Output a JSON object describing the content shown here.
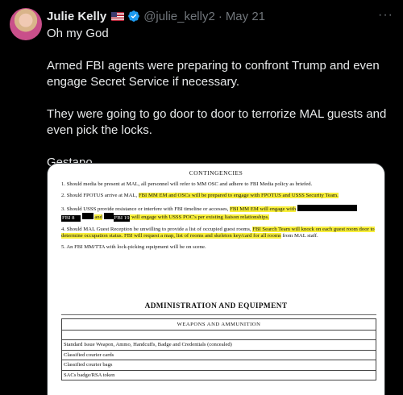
{
  "post": {
    "author_name": "Julie Kelly",
    "handle": "@julie_kelly2",
    "separator": "·",
    "date": "May 21",
    "more_label": "···",
    "paragraphs": [
      "Oh my God",
      "Armed FBI agents were preparing to confront Trump and even engage Secret Service if necessary.",
      "They were going to go door to door to terrorize MAL guests and even pick the locks.",
      "Gestapo"
    ]
  },
  "document": {
    "title": "CONTINGENCIES",
    "items": {
      "i1": "1. Should media be present at MAL, all personnel will refer to MM OSC and adhere to FBI Media policy as briefed.",
      "i2_a": "2. Should FPOTUS arrive at MAL, ",
      "i2_b": "FBI MM EM and OSCs will be prepared to engage with FPOTUS and USSS Security Team.",
      "i3_a": "3. Should USSS provide resistance or interfere with FBI timeline or accesses, ",
      "i3_b": "FBI MM EM will engage with",
      "i3_r1": "FBI 8",
      "i3_and": "and",
      "i3_r2": "FBI 19",
      "i3_c": " will engage with USSS POC's per existing liaison relationships.",
      "i4_a": "4. Should MAL Guest Reception be unwilling to provide a list of occupied guest rooms, ",
      "i4_b": "FBI Search Team will knock on each guest room door to determine occupation status.  FBI will request a map, list of rooms and skeleton key/card for all rooms",
      "i4_c": " from MAL staff.",
      "i5": "5. An FBI MM/TTA with lock-picking equipment will be on scene."
    },
    "section_title": "ADMINISTRATION AND EQUIPMENT",
    "table_header": "WEAPONS AND AMMUNITION",
    "rows": [
      "Standard Issue Weapon, Ammo, Handcuffs, Badge and Credentials (concealed)",
      "Classified courier cards",
      "Classified courier bags",
      "SACs badge/RSA token"
    ]
  },
  "colors": {
    "verified": "#1d9bf0",
    "highlight": "#f8ef3a",
    "muted": "#71767b"
  },
  "icons": {
    "verified": "verified-badge-icon",
    "flag": "us-flag-icon"
  }
}
